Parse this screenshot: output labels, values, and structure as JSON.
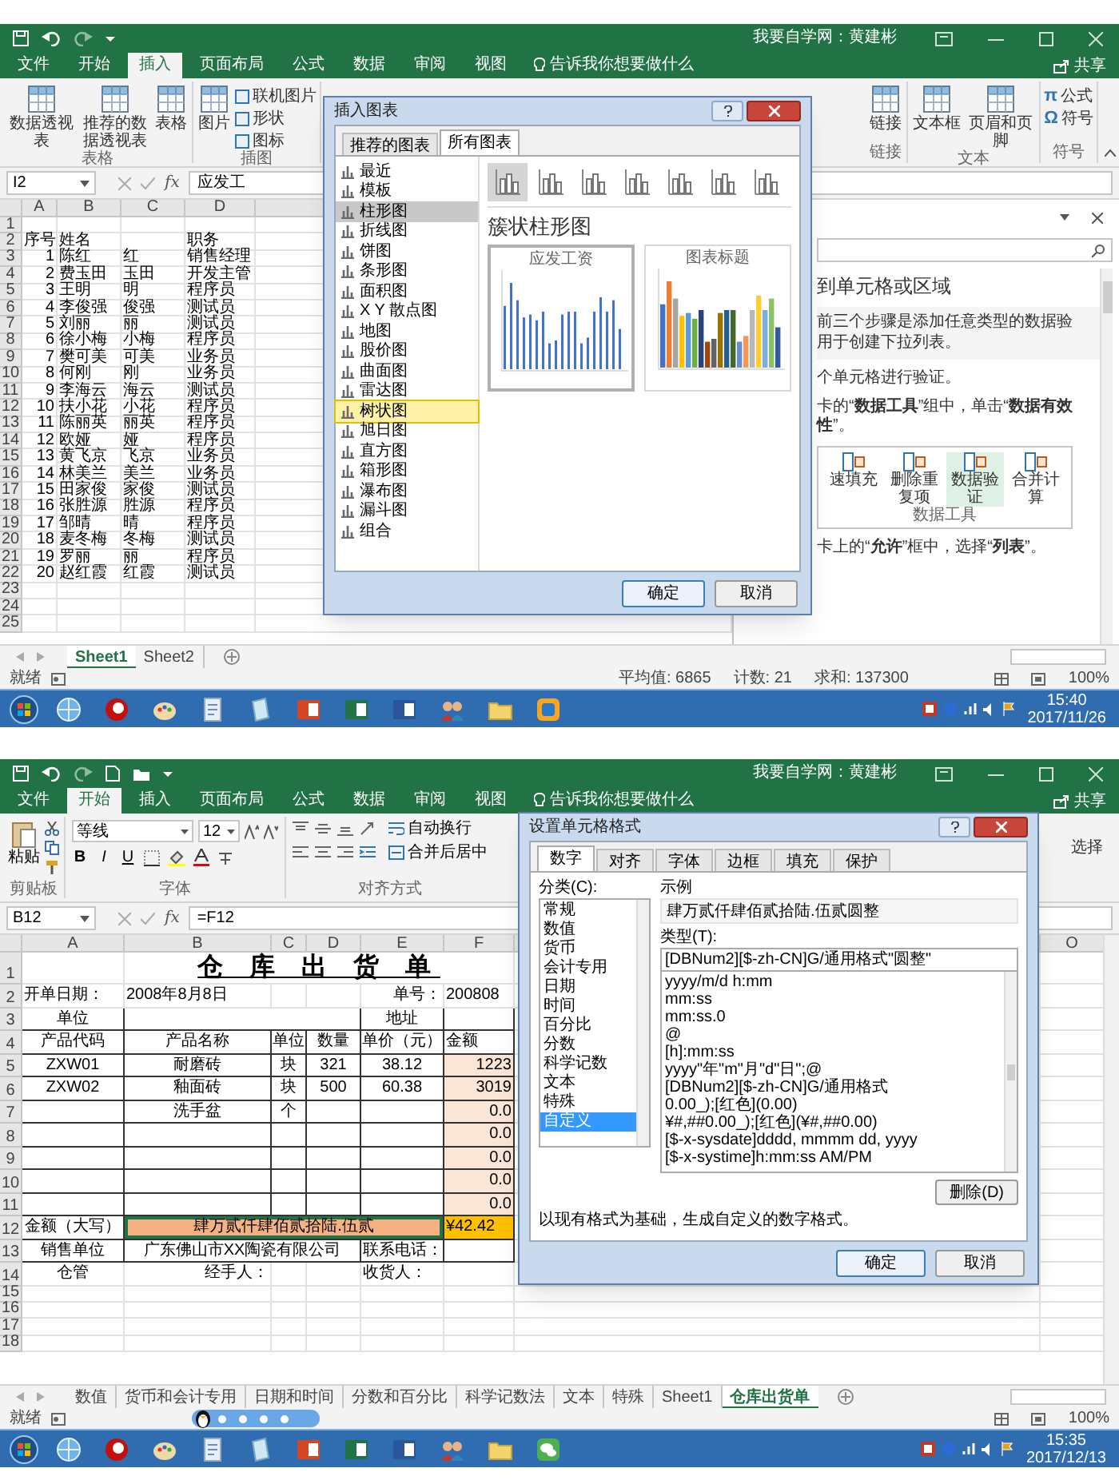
{
  "top_window": {
    "title": "我要自学网：黄建彬",
    "share": "共享",
    "tell_me": "告诉我你想要做什么",
    "tabs": [
      {
        "label": "文件",
        "selected": false
      },
      {
        "label": "开始",
        "selected": false
      },
      {
        "label": "插入",
        "selected": true
      },
      {
        "label": "页面布局",
        "selected": false
      },
      {
        "label": "公式",
        "selected": false
      },
      {
        "label": "数据",
        "selected": false
      },
      {
        "label": "审阅",
        "selected": false
      },
      {
        "label": "视图",
        "selected": false
      }
    ],
    "ribbon_left": [
      {
        "label": "表格",
        "buttons": [
          {
            "kind": "large",
            "label": "数据透视表"
          },
          {
            "kind": "large",
            "label": "推荐的数据透视表"
          },
          {
            "kind": "large",
            "label": "表格"
          }
        ]
      },
      {
        "label": "插图",
        "buttons": [
          {
            "kind": "large",
            "label": "图片"
          },
          {
            "kind": "small",
            "label": "联机图片"
          },
          {
            "kind": "small",
            "label": "形状"
          },
          {
            "kind": "small",
            "label": "图标"
          }
        ]
      }
    ],
    "ribbon_right": [
      {
        "label": "链接",
        "buttons": [
          {
            "kind": "large",
            "label": "链接"
          }
        ]
      },
      {
        "label": "文本",
        "buttons": [
          {
            "kind": "large",
            "label": "文本框"
          },
          {
            "kind": "large",
            "label": "页眉和页脚"
          }
        ]
      },
      {
        "label": "符号",
        "buttons": [
          {
            "kind": "small",
            "glyph": "π",
            "label": "公式"
          },
          {
            "kind": "small",
            "glyph": "Ω",
            "label": "符号"
          }
        ]
      }
    ],
    "name_box": "I2",
    "function_label": "fx",
    "formula": "应发工",
    "columns": [
      "A",
      "B",
      "C",
      "D"
    ],
    "rows": [
      {
        "num": "1",
        "cells": []
      },
      {
        "num": "2",
        "cells": [
          "序号",
          "姓名",
          null,
          "职务"
        ]
      },
      {
        "num": "3",
        "cells": [
          "1",
          "陈红",
          "红",
          "销售经理"
        ]
      },
      {
        "num": "4",
        "cells": [
          "2",
          "费玉田",
          "玉田",
          "开发主管"
        ]
      },
      {
        "num": "5",
        "cells": [
          "3",
          "王明",
          "明",
          "程序员"
        ]
      },
      {
        "num": "6",
        "cells": [
          "4",
          "李俊强",
          "俊强",
          "测试员"
        ]
      },
      {
        "num": "7",
        "cells": [
          "5",
          "刘丽",
          "丽",
          "测试员"
        ]
      },
      {
        "num": "8",
        "cells": [
          "6",
          "徐小梅",
          "小梅",
          "程序员"
        ]
      },
      {
        "num": "9",
        "cells": [
          "7",
          "樊可美",
          "可美",
          "业务员"
        ]
      },
      {
        "num": "10",
        "cells": [
          "8",
          "何刚",
          "刚",
          "业务员"
        ]
      },
      {
        "num": "11",
        "cells": [
          "9",
          "李海云",
          "海云",
          "测试员"
        ]
      },
      {
        "num": "12",
        "cells": [
          "10",
          "扶小花",
          "小花",
          "程序员"
        ]
      },
      {
        "num": "13",
        "cells": [
          "11",
          "陈丽英",
          "丽英",
          "程序员"
        ]
      },
      {
        "num": "14",
        "cells": [
          "12",
          "欧娅",
          "娅",
          "程序员"
        ]
      },
      {
        "num": "15",
        "cells": [
          "13",
          "黄飞京",
          "飞京",
          "业务员"
        ]
      },
      {
        "num": "16",
        "cells": [
          "14",
          "林美兰",
          "美兰",
          "业务员"
        ]
      },
      {
        "num": "17",
        "cells": [
          "15",
          "田家俊",
          "家俊",
          "测试员"
        ]
      },
      {
        "num": "18",
        "cells": [
          "16",
          "张胜源",
          "胜源",
          "程序员"
        ]
      },
      {
        "num": "19",
        "cells": [
          "17",
          "邹晴",
          "晴",
          "程序员"
        ]
      },
      {
        "num": "20",
        "cells": [
          "18",
          "麦冬梅",
          "冬梅",
          "测试员"
        ]
      },
      {
        "num": "21",
        "cells": [
          "19",
          "罗丽",
          "丽",
          "程序员"
        ]
      },
      {
        "num": "22",
        "cells": [
          "20",
          "赵红霞",
          "红霞",
          "测试员"
        ]
      },
      {
        "num": "23",
        "cells": []
      },
      {
        "num": "24",
        "cells": []
      },
      {
        "num": "25",
        "cells": []
      }
    ],
    "task_pane": {
      "heading": "到单元格或区域",
      "lines": [
        "前三个步骤是添加任意类型的数据验",
        "用于创建下拉列表。",
        "个单元格进行验证。",
        "卡的“**数据工具**”组中，单击“**数据有效性**”。"
      ],
      "tools": [
        {
          "label": "速填充",
          "selected": false
        },
        {
          "label": "删除重复项",
          "selected": false
        },
        {
          "label": "数据验证",
          "selected": true
        },
        {
          "label": "合并计算",
          "selected": false
        }
      ],
      "tools_group": "数据工具",
      "last_line": "卡上的“**允许**”框中，选择“**列表**”。"
    },
    "dialog": {
      "title": "插入图表",
      "tabs": [
        {
          "label": "推荐的图表",
          "selected": false
        },
        {
          "label": "所有图表",
          "selected": true
        }
      ],
      "types": [
        {
          "label": "最近",
          "selected": false,
          "hovered": false
        },
        {
          "label": "模板",
          "selected": false,
          "hovered": false
        },
        {
          "label": "柱形图",
          "selected": true,
          "hovered": false
        },
        {
          "label": "折线图",
          "selected": false,
          "hovered": false
        },
        {
          "label": "饼图",
          "selected": false,
          "hovered": false
        },
        {
          "label": "条形图",
          "selected": false,
          "hovered": false
        },
        {
          "label": "面积图",
          "selected": false,
          "hovered": false
        },
        {
          "label": "X Y 散点图",
          "selected": false,
          "hovered": false
        },
        {
          "label": "地图",
          "selected": false,
          "hovered": false
        },
        {
          "label": "股价图",
          "selected": false,
          "hovered": false
        },
        {
          "label": "曲面图",
          "selected": false,
          "hovered": false
        },
        {
          "label": "雷达图",
          "selected": false,
          "hovered": false
        },
        {
          "label": "树状图",
          "selected": false,
          "hovered": true
        },
        {
          "label": "旭日图",
          "selected": false,
          "hovered": false
        },
        {
          "label": "直方图",
          "selected": false,
          "hovered": false
        },
        {
          "label": "箱形图",
          "selected": false,
          "hovered": false
        },
        {
          "label": "瀑布图",
          "selected": false,
          "hovered": false
        },
        {
          "label": "漏斗图",
          "selected": false,
          "hovered": false
        },
        {
          "label": "组合",
          "selected": false,
          "hovered": false
        }
      ],
      "subtypes": [
        {
          "selected": true
        },
        {
          "selected": false
        },
        {
          "selected": false
        },
        {
          "selected": false
        },
        {
          "selected": false
        },
        {
          "selected": false
        },
        {
          "selected": false
        }
      ],
      "heading": "簇状柱形图",
      "previews": [
        {
          "title": "应发工资",
          "selected": true
        },
        {
          "title": "图表标题",
          "selected": false
        }
      ],
      "buttons": [
        "确定",
        "取消"
      ]
    },
    "sheets": [
      {
        "label": "Sheet1",
        "selected": true
      },
      {
        "label": "Sheet2",
        "selected": false
      }
    ],
    "status": "就绪",
    "stats": [
      "平均值: 6865",
      "计数: 21",
      "求和: 137300"
    ],
    "zoom": "100%",
    "clock": {
      "time": "15:40",
      "date": "2017/11/26"
    }
  },
  "bottom_window": {
    "title": "我要自学网：黄建彬",
    "share": "共享",
    "tell_me": "告诉我你想要做什么",
    "tabs": [
      {
        "label": "文件",
        "selected": false
      },
      {
        "label": "开始",
        "selected": true
      },
      {
        "label": "插入",
        "selected": false
      },
      {
        "label": "页面布局",
        "selected": false
      },
      {
        "label": "公式",
        "selected": false
      },
      {
        "label": "数据",
        "selected": false
      },
      {
        "label": "审阅",
        "selected": false
      },
      {
        "label": "视图",
        "selected": false
      }
    ],
    "ribbon": {
      "paste": "粘贴",
      "clipboard": "剪贴板",
      "font": "等线",
      "size": "12",
      "format_buttons": [
        "B",
        "I",
        "U"
      ],
      "font_group": "字体",
      "wrap": "自动换行",
      "merge": "合并后居中",
      "align_group": "对齐方式",
      "find_fragment": "选择"
    },
    "name_box": "B12",
    "function_label": "fx",
    "formula": "=F12",
    "columns": [
      "A",
      "B",
      "C",
      "D",
      "E",
      "F"
    ],
    "last_column": "O",
    "rows": [
      {
        "num": "1",
        "kind": "plain",
        "cells": [
          null,
          {
            "text": "仓 库 出 货 单",
            "kind": "title"
          },
          null,
          null,
          null,
          null
        ]
      },
      {
        "num": "2",
        "kind": "plain",
        "cells": [
          {
            "text": "开单日期：",
            "kind": "text"
          },
          {
            "text": "2008年8月8日",
            "kind": "text"
          },
          null,
          null,
          {
            "text": "单号：",
            "kind": "right"
          },
          {
            "text": "200808",
            "kind": "text"
          }
        ]
      },
      {
        "num": "3",
        "kind": "boxed",
        "cells": [
          {
            "text": "单位"
          },
          null,
          null,
          null,
          {
            "text": "地址"
          },
          null
        ]
      },
      {
        "num": "4",
        "kind": "boxed",
        "cells": [
          {
            "text": "产品代码"
          },
          {
            "text": "产品名称"
          },
          {
            "text": "单位"
          },
          {
            "text": "数量"
          },
          {
            "text": "单价（元）"
          },
          {
            "text": "金额",
            "kind": "text"
          }
        ]
      },
      {
        "num": "5",
        "kind": "boxed",
        "cells": [
          {
            "text": "ZXW01"
          },
          {
            "text": "耐磨砖"
          },
          {
            "text": "块"
          },
          {
            "text": "321"
          },
          {
            "text": "38.12"
          },
          {
            "text": "1223",
            "kind": "money"
          }
        ]
      },
      {
        "num": "6",
        "kind": "boxed",
        "cells": [
          {
            "text": "ZXW02"
          },
          {
            "text": "釉面砖"
          },
          {
            "text": "块"
          },
          {
            "text": "500"
          },
          {
            "text": "60.38"
          },
          {
            "text": "3019",
            "kind": "money"
          }
        ]
      },
      {
        "num": "7",
        "kind": "boxed",
        "cells": [
          null,
          {
            "text": "洗手盆"
          },
          {
            "text": "个"
          },
          null,
          null,
          {
            "text": "0.0",
            "kind": "money"
          }
        ]
      },
      {
        "num": "8",
        "kind": "boxed",
        "cells": [
          null,
          null,
          null,
          null,
          null,
          {
            "text": "0.0",
            "kind": "money"
          }
        ]
      },
      {
        "num": "9",
        "kind": "boxed",
        "cells": [
          null,
          null,
          null,
          null,
          null,
          {
            "text": "0.0",
            "kind": "money"
          }
        ]
      },
      {
        "num": "10",
        "kind": "boxed",
        "cells": [
          null,
          null,
          null,
          null,
          null,
          {
            "text": "0.0",
            "kind": "money"
          }
        ]
      },
      {
        "num": "11",
        "kind": "boxed",
        "cells": [
          null,
          null,
          null,
          null,
          null,
          {
            "text": "0.0",
            "kind": "money"
          }
        ]
      },
      {
        "num": "12",
        "kind": "boxed",
        "cells": [
          {
            "text": "金额（大写）"
          },
          {
            "text": "肆万贰仟肆佰贰拾陆.伍贰",
            "kind": "total"
          },
          null,
          null,
          null,
          {
            "text": "¥42.42",
            "kind": "total_value"
          }
        ]
      },
      {
        "num": "13",
        "kind": "boxed",
        "cells": [
          {
            "text": "销售单位"
          },
          {
            "text": "广东佛山市XX陶瓷有限公司"
          },
          null,
          null,
          {
            "text": "联系电话：",
            "kind": "text"
          },
          null
        ]
      },
      {
        "num": "14",
        "kind": "plain",
        "cells": [
          {
            "text": "仓管"
          },
          {
            "text": "经手人：",
            "kind": "right"
          },
          null,
          null,
          {
            "text": "收货人：",
            "kind": "text"
          },
          null
        ]
      },
      {
        "num": "15",
        "kind": "plain",
        "cells": []
      },
      {
        "num": "16",
        "kind": "plain",
        "cells": []
      },
      {
        "num": "17",
        "kind": "plain",
        "cells": []
      },
      {
        "num": "18",
        "kind": "plain",
        "cells": []
      }
    ],
    "dialog": {
      "title": "设置单元格格式",
      "tabs": [
        {
          "label": "数字",
          "selected": true
        },
        {
          "label": "对齐",
          "selected": false
        },
        {
          "label": "字体",
          "selected": false
        },
        {
          "label": "边框",
          "selected": false
        },
        {
          "label": "填充",
          "selected": false
        },
        {
          "label": "保护",
          "selected": false
        }
      ],
      "category_label": "分类(C):",
      "categories": [
        {
          "label": "常规",
          "selected": false
        },
        {
          "label": "数值",
          "selected": false
        },
        {
          "label": "货币",
          "selected": false
        },
        {
          "label": "会计专用",
          "selected": false
        },
        {
          "label": "日期",
          "selected": false
        },
        {
          "label": "时间",
          "selected": false
        },
        {
          "label": "百分比",
          "selected": false
        },
        {
          "label": "分数",
          "selected": false
        },
        {
          "label": "科学记数",
          "selected": false
        },
        {
          "label": "文本",
          "selected": false
        },
        {
          "label": "特殊",
          "selected": false
        },
        {
          "label": "自定义",
          "selected": true
        }
      ],
      "sample_label": "示例",
      "sample": "肆万贰仟肆佰贰拾陆.伍贰圆整",
      "type_label": "类型(T):",
      "type_value": "[DBNum2][$-zh-CN]G/通用格式\"圆整\"",
      "types": [
        "yyyy/m/d h:mm",
        "mm:ss",
        "mm:ss.0",
        "@",
        "[h]:mm:ss",
        "yyyy\"年\"m\"月\"d\"日\";@",
        "[DBNum2][$-zh-CN]G/通用格式",
        "0.00_);[红色](0.00)",
        "¥#,##0.00_);[红色](¥#,##0.00)",
        "[$-x-sysdate]dddd, mmmm dd, yyyy",
        "[$-x-systime]h:mm:ss AM/PM"
      ],
      "delete": "删除(D)",
      "description": "以现有格式为基础，生成自定义的数字格式。",
      "buttons": [
        "确定",
        "取消"
      ]
    },
    "sheets": [
      {
        "label": "数值",
        "selected": false
      },
      {
        "label": "货币和会计专用",
        "selected": false
      },
      {
        "label": "日期和时间",
        "selected": false
      },
      {
        "label": "分数和百分比",
        "selected": false
      },
      {
        "label": "科学记数法",
        "selected": false
      },
      {
        "label": "文本",
        "selected": false
      },
      {
        "label": "特殊",
        "selected": false
      },
      {
        "label": "Sheet1",
        "selected": false
      },
      {
        "label": "仓库出货单",
        "selected": true
      }
    ],
    "status": "就绪",
    "zoom": "100%",
    "clock": {
      "time": "15:35",
      "date": "2017/12/13"
    }
  }
}
